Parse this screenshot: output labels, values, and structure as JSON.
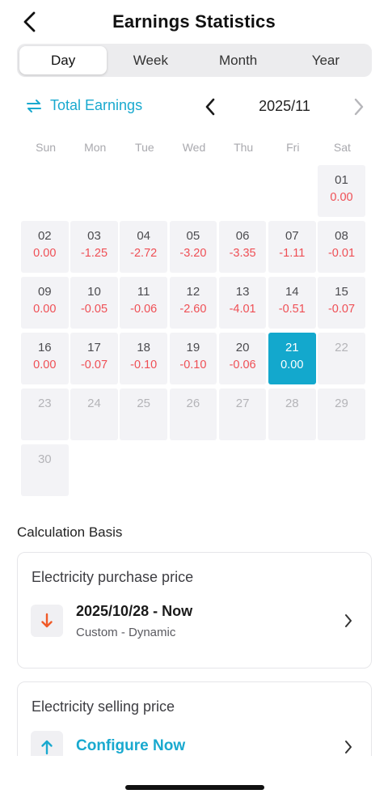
{
  "header": {
    "title": "Earnings Statistics"
  },
  "tabs": [
    {
      "label": "Day",
      "active": true
    },
    {
      "label": "Week",
      "active": false
    },
    {
      "label": "Month",
      "active": false
    },
    {
      "label": "Year",
      "active": false
    }
  ],
  "toolbar": {
    "total_label": "Total Earnings",
    "month": "2025/11"
  },
  "weekdays": [
    "Sun",
    "Mon",
    "Tue",
    "Wed",
    "Thu",
    "Fri",
    "Sat"
  ],
  "calendar": {
    "first_weekday_index": 6,
    "selected_day": "21",
    "days": [
      {
        "day": "01",
        "value": "0.00"
      },
      {
        "day": "02",
        "value": "0.00"
      },
      {
        "day": "03",
        "value": "-1.25"
      },
      {
        "day": "04",
        "value": "-2.72"
      },
      {
        "day": "05",
        "value": "-3.20"
      },
      {
        "day": "06",
        "value": "-3.35"
      },
      {
        "day": "07",
        "value": "-1.11"
      },
      {
        "day": "08",
        "value": "-0.01"
      },
      {
        "day": "09",
        "value": "0.00"
      },
      {
        "day": "10",
        "value": "-0.05"
      },
      {
        "day": "11",
        "value": "-0.06"
      },
      {
        "day": "12",
        "value": "-2.60"
      },
      {
        "day": "13",
        "value": "-4.01"
      },
      {
        "day": "14",
        "value": "-0.51"
      },
      {
        "day": "15",
        "value": "-0.07"
      },
      {
        "day": "16",
        "value": "0.00"
      },
      {
        "day": "17",
        "value": "-0.07"
      },
      {
        "day": "18",
        "value": "-0.10"
      },
      {
        "day": "19",
        "value": "-0.10"
      },
      {
        "day": "20",
        "value": "-0.06"
      },
      {
        "day": "21",
        "value": "0.00"
      },
      {
        "day": "22",
        "value": ""
      },
      {
        "day": "23",
        "value": ""
      },
      {
        "day": "24",
        "value": ""
      },
      {
        "day": "25",
        "value": ""
      },
      {
        "day": "26",
        "value": ""
      },
      {
        "day": "27",
        "value": ""
      },
      {
        "day": "28",
        "value": ""
      },
      {
        "day": "29",
        "value": ""
      },
      {
        "day": "30",
        "value": ""
      }
    ]
  },
  "calculation": {
    "title": "Calculation Basis",
    "purchase": {
      "title": "Electricity purchase price",
      "period": "2025/10/28 - Now",
      "mode": "Custom - Dynamic"
    },
    "selling": {
      "title": "Electricity selling price",
      "action": "Configure Now"
    }
  },
  "colors": {
    "accent": "#19a9cf",
    "negative": "#ef4f55",
    "selected_cell": "#13a8cd",
    "down_arrow": "#f05a28"
  }
}
